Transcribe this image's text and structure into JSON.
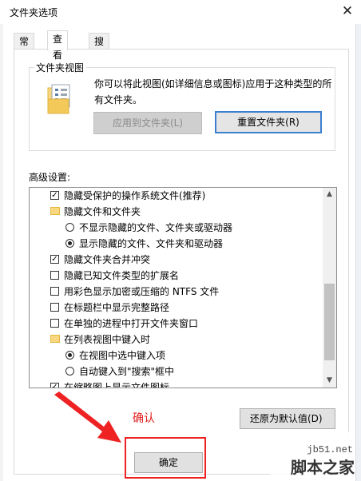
{
  "window": {
    "title": "文件夹选项"
  },
  "tabs": [
    "常规",
    "查看",
    "搜索"
  ],
  "folder_view": {
    "legend": "文件夹视图",
    "description": "你可以将此视图(如详细信息或图标)应用于这种类型的所有文件夹。",
    "apply_button": "应用到文件夹(L)",
    "reset_button": "重置文件夹(R)"
  },
  "advanced": {
    "label": "高级设置:",
    "items": [
      {
        "kind": "checkbox",
        "checked": true,
        "label": "隐藏受保护的操作系统文件(推荐)"
      },
      {
        "kind": "folder",
        "label": "隐藏文件和文件夹"
      },
      {
        "kind": "radio",
        "checked": false,
        "label": "不显示隐藏的文件、文件夹或驱动器"
      },
      {
        "kind": "radio",
        "checked": true,
        "label": "显示隐藏的文件、文件夹和驱动器"
      },
      {
        "kind": "checkbox",
        "checked": true,
        "label": "隐藏文件夹合并冲突"
      },
      {
        "kind": "checkbox",
        "checked": false,
        "label": "隐藏已知文件类型的扩展名"
      },
      {
        "kind": "checkbox",
        "checked": false,
        "label": "用彩色显示加密或压缩的 NTFS 文件"
      },
      {
        "kind": "checkbox",
        "checked": false,
        "label": "在标题栏中显示完整路径"
      },
      {
        "kind": "checkbox",
        "checked": false,
        "label": "在单独的进程中打开文件夹窗口"
      },
      {
        "kind": "folder",
        "label": "在列表视图中键入时"
      },
      {
        "kind": "radio",
        "checked": true,
        "label": "在视图中选中键入项"
      },
      {
        "kind": "radio",
        "checked": false,
        "label": "自动键入到\"搜索\"框中"
      },
      {
        "kind": "checkbox",
        "checked": true,
        "label": "在缩略图上显示文件图标"
      }
    ]
  },
  "annotation": {
    "confirm": "确认"
  },
  "buttons": {
    "restore": "还原为默认值(D)",
    "ok": "确定"
  },
  "watermark": {
    "url": "jb51.net",
    "name": "脚本之家"
  },
  "colors": {
    "focus_blue": "#3c7fd0",
    "annotation_red": "#e02020",
    "folder_yellow": "#f7d77f"
  }
}
